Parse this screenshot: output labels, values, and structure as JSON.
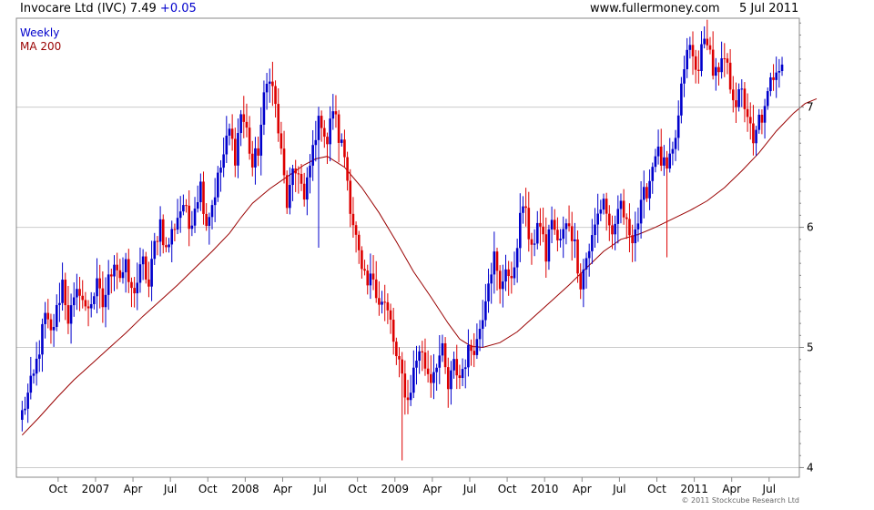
{
  "header": {
    "title": "Invocare Ltd (IVC) 7.49",
    "change": "+0.05",
    "site": "www.fullermoney.com",
    "date": "5 Jul 2011"
  },
  "footer": {
    "copyright": "© 2011 Stockcube Research Ltd"
  },
  "colors": {
    "up": "#0000cc",
    "down": "#dd0000",
    "ma": "#990000",
    "grid": "#cccccc"
  },
  "chart_data": {
    "type": "candlestick",
    "frequency": "Weekly",
    "x_tick_labels": [
      "Oct",
      "2007",
      "Apr",
      "Jul",
      "Oct",
      "2008",
      "Apr",
      "Jul",
      "Oct",
      "2009",
      "Apr",
      "Jul",
      "Oct",
      "2010",
      "Apr",
      "Jul",
      "Oct",
      "2011",
      "Apr",
      "Jul"
    ],
    "y_ticks": [
      4,
      5,
      6,
      7
    ],
    "ylim": [
      3.92,
      7.74
    ],
    "grid": true,
    "series": [
      {
        "name": "MA 200",
        "type": "line",
        "points": [
          [
            0,
            4.27
          ],
          [
            6,
            4.42
          ],
          [
            12,
            4.58
          ],
          [
            18,
            4.73
          ],
          [
            24,
            4.86
          ],
          [
            30,
            4.99
          ],
          [
            36,
            5.12
          ],
          [
            42,
            5.26
          ],
          [
            48,
            5.39
          ],
          [
            54,
            5.52
          ],
          [
            60,
            5.66
          ],
          [
            66,
            5.8
          ],
          [
            72,
            5.95
          ],
          [
            76,
            6.08
          ],
          [
            80,
            6.2
          ],
          [
            86,
            6.32
          ],
          [
            92,
            6.42
          ],
          [
            98,
            6.52
          ],
          [
            102,
            6.57
          ],
          [
            106,
            6.59
          ],
          [
            112,
            6.5
          ],
          [
            118,
            6.33
          ],
          [
            124,
            6.12
          ],
          [
            130,
            5.88
          ],
          [
            136,
            5.63
          ],
          [
            142,
            5.42
          ],
          [
            148,
            5.2
          ],
          [
            152,
            5.07
          ],
          [
            156,
            5.01
          ],
          [
            160,
            5.0
          ],
          [
            166,
            5.04
          ],
          [
            172,
            5.13
          ],
          [
            178,
            5.26
          ],
          [
            184,
            5.39
          ],
          [
            190,
            5.52
          ],
          [
            196,
            5.66
          ],
          [
            202,
            5.8
          ],
          [
            208,
            5.9
          ],
          [
            214,
            5.94
          ],
          [
            220,
            6.0
          ],
          [
            226,
            6.07
          ],
          [
            232,
            6.14
          ],
          [
            238,
            6.22
          ],
          [
            244,
            6.33
          ],
          [
            250,
            6.47
          ],
          [
            256,
            6.62
          ],
          [
            262,
            6.8
          ],
          [
            268,
            6.95
          ],
          [
            272,
            7.03
          ],
          [
            276,
            7.07
          ]
        ]
      },
      {
        "name": "Weekly",
        "type": "candlestick",
        "anchors": [
          [
            0,
            4.45
          ],
          [
            2,
            4.6
          ],
          [
            4,
            4.75
          ],
          [
            6,
            5.0
          ],
          [
            8,
            5.25
          ],
          [
            10,
            5.1
          ],
          [
            12,
            5.3
          ],
          [
            14,
            5.55
          ],
          [
            16,
            5.25
          ],
          [
            18,
            5.35
          ],
          [
            20,
            5.5
          ],
          [
            22,
            5.3
          ],
          [
            24,
            5.4
          ],
          [
            26,
            5.5
          ],
          [
            28,
            5.35
          ],
          [
            30,
            5.55
          ],
          [
            32,
            5.75
          ],
          [
            34,
            5.6
          ],
          [
            36,
            5.65
          ],
          [
            38,
            5.45
          ],
          [
            40,
            5.55
          ],
          [
            42,
            5.7
          ],
          [
            44,
            5.5
          ],
          [
            46,
            5.85
          ],
          [
            48,
            6.05
          ],
          [
            50,
            5.8
          ],
          [
            52,
            5.95
          ],
          [
            54,
            6.1
          ],
          [
            56,
            6.2
          ],
          [
            58,
            6.0
          ],
          [
            60,
            6.2
          ],
          [
            62,
            6.35
          ],
          [
            64,
            6.05
          ],
          [
            66,
            6.2
          ],
          [
            68,
            6.4
          ],
          [
            70,
            6.6
          ],
          [
            72,
            6.8
          ],
          [
            74,
            6.6
          ],
          [
            76,
            6.95
          ],
          [
            78,
            6.8
          ],
          [
            80,
            6.5
          ],
          [
            82,
            6.65
          ],
          [
            84,
            7.05
          ],
          [
            86,
            7.3
          ],
          [
            88,
            7.0
          ],
          [
            90,
            6.6
          ],
          [
            92,
            6.2
          ],
          [
            94,
            6.4
          ],
          [
            96,
            6.5
          ],
          [
            98,
            6.2
          ],
          [
            100,
            6.5
          ],
          [
            102,
            6.8
          ],
          [
            104,
            6.9
          ],
          [
            106,
            6.7
          ],
          [
            108,
            7.0
          ],
          [
            110,
            6.75
          ],
          [
            112,
            6.6
          ],
          [
            114,
            6.2
          ],
          [
            116,
            5.9
          ],
          [
            118,
            5.6
          ],
          [
            120,
            5.5
          ],
          [
            122,
            5.6
          ],
          [
            124,
            5.4
          ],
          [
            126,
            5.35
          ],
          [
            128,
            5.2
          ],
          [
            130,
            4.9
          ],
          [
            132,
            4.75
          ],
          [
            134,
            4.55
          ],
          [
            136,
            4.8
          ],
          [
            138,
            5.0
          ],
          [
            140,
            4.85
          ],
          [
            142,
            4.75
          ],
          [
            144,
            4.9
          ],
          [
            146,
            4.95
          ],
          [
            148,
            4.65
          ],
          [
            150,
            4.85
          ],
          [
            152,
            4.75
          ],
          [
            154,
            4.9
          ],
          [
            156,
            5.0
          ],
          [
            158,
            5.05
          ],
          [
            160,
            5.3
          ],
          [
            162,
            5.6
          ],
          [
            164,
            5.75
          ],
          [
            166,
            5.45
          ],
          [
            168,
            5.7
          ],
          [
            170,
            5.5
          ],
          [
            172,
            5.9
          ],
          [
            174,
            6.2
          ],
          [
            176,
            5.95
          ],
          [
            178,
            5.85
          ],
          [
            180,
            6.05
          ],
          [
            182,
            5.75
          ],
          [
            184,
            6.1
          ],
          [
            186,
            5.85
          ],
          [
            188,
            5.95
          ],
          [
            190,
            6.05
          ],
          [
            192,
            5.85
          ],
          [
            194,
            5.55
          ],
          [
            196,
            5.75
          ],
          [
            198,
            5.9
          ],
          [
            200,
            6.1
          ],
          [
            202,
            6.25
          ],
          [
            204,
            6.0
          ],
          [
            206,
            5.95
          ],
          [
            208,
            6.2
          ],
          [
            210,
            6.0
          ],
          [
            212,
            5.95
          ],
          [
            214,
            6.05
          ],
          [
            216,
            6.25
          ],
          [
            218,
            6.4
          ],
          [
            220,
            6.65
          ],
          [
            222,
            6.55
          ],
          [
            224,
            6.45
          ],
          [
            226,
            6.6
          ],
          [
            228,
            6.9
          ],
          [
            230,
            7.35
          ],
          [
            232,
            7.5
          ],
          [
            234,
            7.3
          ],
          [
            236,
            7.45
          ],
          [
            238,
            7.6
          ],
          [
            240,
            7.3
          ],
          [
            242,
            7.25
          ],
          [
            244,
            7.4
          ],
          [
            246,
            7.2
          ],
          [
            248,
            7.05
          ],
          [
            250,
            7.1
          ],
          [
            252,
            6.95
          ],
          [
            254,
            6.65
          ],
          [
            256,
            6.9
          ],
          [
            258,
            6.95
          ],
          [
            260,
            7.2
          ],
          [
            262,
            7.35
          ],
          [
            264,
            7.4
          ]
        ],
        "low_extremes": [
          [
            132,
            4.06
          ],
          [
            103,
            5.83
          ],
          [
            224,
            5.75
          ]
        ]
      }
    ]
  }
}
